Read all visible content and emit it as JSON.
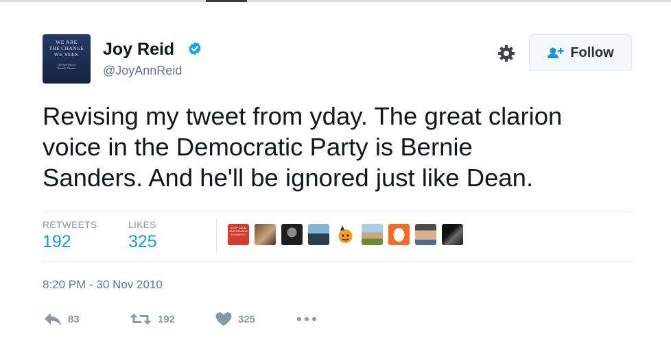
{
  "author": {
    "name": "Joy Reid",
    "handle": "@JoyAnnReid",
    "avatar_text": {
      "line1": "WE ARE",
      "line2": "THE CHANGE",
      "line3": "WE SEEK",
      "line4": "The Speeches of",
      "line5": "Barack Obama"
    },
    "verified_icon": "verified-badge-icon"
  },
  "actions_top": {
    "settings_icon": "gear-icon",
    "follow_label": "Follow",
    "follow_icon": "add-user-icon"
  },
  "tweet": {
    "lines": [
      "Revising my tweet from yday. The great clarion",
      "voice in the Democratic Party is Bernie",
      "Sanders. And he'll be ignored just like Dean."
    ]
  },
  "stats": {
    "retweets_label": "RETWEETS",
    "retweets_value": "192",
    "likes_label": "LIKES",
    "likes_value": "325"
  },
  "liker_avatars": [
    {
      "name": "keep-calm-avatar",
      "text": "KEEP CALM AND DEMAND EVIDENCE"
    },
    {
      "name": "person-avatar-1"
    },
    {
      "name": "person-avatar-2"
    },
    {
      "name": "person-avatar-3"
    },
    {
      "name": "cartoon-avatar"
    },
    {
      "name": "person-avatar-4"
    },
    {
      "name": "orange-egg-avatar"
    },
    {
      "name": "person-avatar-5"
    },
    {
      "name": "person-avatar-6"
    }
  ],
  "timestamp": "8:20 PM - 30 Nov 2010",
  "footer": {
    "reply_count": "83",
    "retweet_count": "192",
    "like_count": "325",
    "reply_icon": "reply-icon",
    "retweet_icon": "retweet-icon",
    "like_icon": "heart-icon",
    "more_icon": "more-dots-icon"
  },
  "colors": {
    "accent": "#1b95e0",
    "text": "#14171a",
    "muted": "#657786",
    "verified": "#1da1f2"
  }
}
